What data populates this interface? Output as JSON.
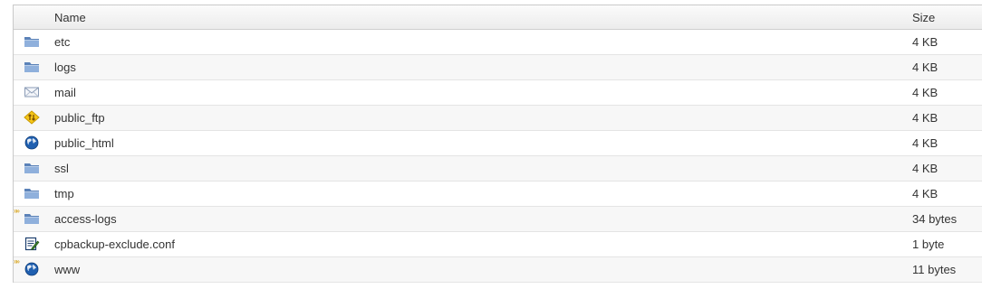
{
  "table": {
    "columns": {
      "name": "Name",
      "size": "Size"
    },
    "rows": [
      {
        "name": "etc",
        "size": "4 KB",
        "icon": "folder-icon",
        "symlink": false
      },
      {
        "name": "logs",
        "size": "4 KB",
        "icon": "folder-icon",
        "symlink": false
      },
      {
        "name": "mail",
        "size": "4 KB",
        "icon": "mail-folder-icon",
        "symlink": false
      },
      {
        "name": "public_ftp",
        "size": "4 KB",
        "icon": "ftp-folder-icon",
        "symlink": false
      },
      {
        "name": "public_html",
        "size": "4 KB",
        "icon": "globe-folder-icon",
        "symlink": false
      },
      {
        "name": "ssl",
        "size": "4 KB",
        "icon": "folder-icon",
        "symlink": false
      },
      {
        "name": "tmp",
        "size": "4 KB",
        "icon": "folder-icon",
        "symlink": false
      },
      {
        "name": "access-logs",
        "size": "34 bytes",
        "icon": "folder-icon",
        "symlink": true
      },
      {
        "name": "cpbackup-exclude.conf",
        "size": "1 byte",
        "icon": "text-file-icon",
        "symlink": false
      },
      {
        "name": "www",
        "size": "11 bytes",
        "icon": "globe-folder-icon",
        "symlink": true
      }
    ]
  },
  "colors": {
    "folder": "#5b82b8",
    "folder_light": "#8fb0dc",
    "row_alt_bg": "#f7f7f7",
    "border": "#e4e4e4"
  }
}
